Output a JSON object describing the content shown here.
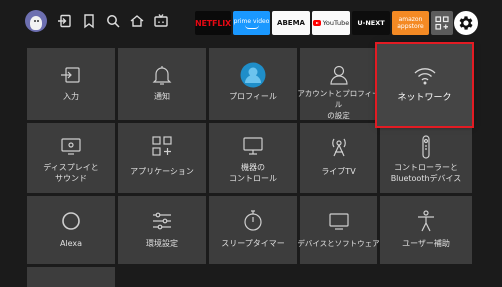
{
  "topbar": {
    "nav_icons": [
      "input-icon",
      "bookmark-icon",
      "search-icon",
      "home-icon",
      "live-tv-icon"
    ],
    "apps": {
      "netflix": "NETFLIX",
      "prime_line1": "prime video",
      "abema": "ABEMA",
      "youtube": "YouTube",
      "unext": "U-NEXT",
      "amazon_line1": "amazon",
      "amazon_line2": "appstore"
    }
  },
  "tiles": {
    "input": "入力",
    "notifications": "通知",
    "profile": "プロフィール",
    "account": "アカウントとプロフィール\nの設定",
    "network": "ネットワーク",
    "display_sound": "ディスプレイと\nサウンド",
    "applications": "アプリケーション",
    "device": "機器の\nコントロール",
    "livetv": "ライブTV",
    "controllers": "コントローラーと\nBluetoothデバイス",
    "alexa": "Alexa",
    "preferences": "環境設定",
    "sleep_timer": "スリープタイマー",
    "device_software": "デバイスとソフトウェア",
    "accessibility": "ユーザー補助"
  },
  "colors": {
    "background": "#1b1b1b",
    "tile": "#3d3d3d",
    "focus_border": "#e31b23",
    "profile_accent": "#1f8ec9"
  }
}
